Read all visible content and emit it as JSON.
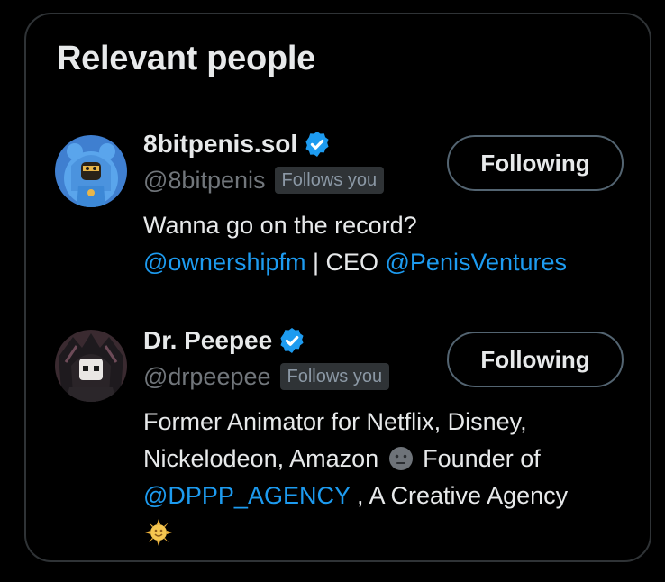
{
  "section": {
    "title": "Relevant people"
  },
  "colors": {
    "accent": "#1d9bf0",
    "background": "#000000",
    "muted": "#71767b",
    "border": "#2f3336"
  },
  "people": [
    {
      "display_name": "8bitpenis.sol",
      "verified": true,
      "handle": "@8bitpenis",
      "follows_you_label": "Follows you",
      "button_label": "Following",
      "avatar_icon": "blue-bear-hooded-avatar",
      "bio": {
        "line1": "Wanna go on the record?",
        "mention1": "@ownershipfm",
        "separator": " | CEO ",
        "mention2": "@PenisVentures"
      }
    },
    {
      "display_name": "Dr. Peepee",
      "verified": true,
      "handle": "@drpeepee",
      "follows_you_label": "Follows you",
      "button_label": "Following",
      "avatar_icon": "hooded-robot-avatar",
      "bio": {
        "text1": "Former Animator for Netflix, Disney, Nickelodeon, Amazon ",
        "emoji1": "neutral-face-emoji",
        "text2": " Founder of ",
        "mention1": "@DPPP_AGENCY",
        "text3": " , A Creative Agency ",
        "emoji2": "sun-with-face-emoji"
      }
    }
  ]
}
